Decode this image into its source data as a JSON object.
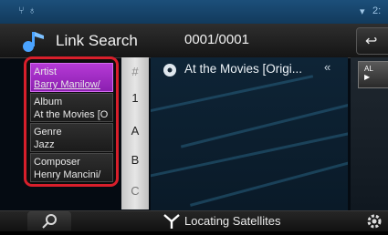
{
  "status": {
    "icons": [
      "signal-icon",
      "bluetooth-icon",
      "wifi-icon"
    ],
    "clock": "2:"
  },
  "header": {
    "title": "Link Search",
    "counter": "0001/0001",
    "back_icon": "return-arrow-icon"
  },
  "categories": [
    {
      "label": "Artist",
      "value": "Barry Manilow/",
      "selected": true
    },
    {
      "label": "Album",
      "value": "At the Movies [O",
      "selected": false
    },
    {
      "label": "Genre",
      "value": "Jazz",
      "selected": false
    },
    {
      "label": "Composer",
      "value": "Henry Mancini/",
      "selected": false
    }
  ],
  "index_strip": [
    "#",
    "1",
    "A",
    "B",
    "C"
  ],
  "list": {
    "rows": [
      {
        "icon": "disc-icon",
        "text": "At the Movies [Origi...",
        "arrow": "«"
      }
    ]
  },
  "right_panel": {
    "all_label": "AL"
  },
  "footer": {
    "status_text": "Locating Satellites"
  },
  "colors": {
    "selected": "#a52ccb",
    "highlight_border": "#d81f2b",
    "list_bg": "#0e2436",
    "index_strip": "#d7d7d7"
  }
}
